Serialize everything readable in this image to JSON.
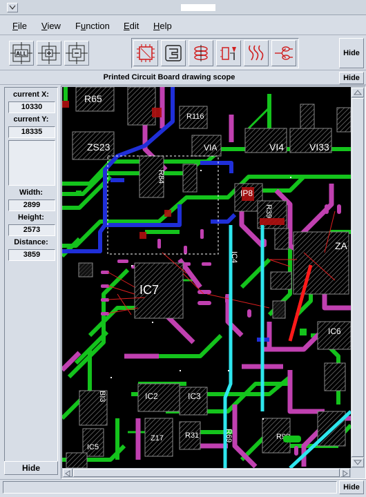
{
  "window": {
    "title_bar_label": "",
    "window_menu_icon": "window-menu-icon"
  },
  "menubar": {
    "items": [
      {
        "label": "File",
        "key": "F",
        "rest": "ile"
      },
      {
        "label": "View",
        "key": "V",
        "rest": "iew"
      },
      {
        "label": "Function",
        "key": "u",
        "pre": "F",
        "rest": "nction"
      },
      {
        "label": "Edit",
        "key": "E",
        "rest": "dit"
      },
      {
        "label": "Help",
        "key": "H",
        "rest": "elp"
      }
    ]
  },
  "toolbar": {
    "left_tools": [
      "zoom-all-icon",
      "zoom-in-icon",
      "zoom-out-icon"
    ],
    "zoom_all_label": "ALL",
    "right_tools": [
      "pcb-board-icon",
      "footprint-icon",
      "layers-icon",
      "component-probe-icon",
      "signal-traces-icon",
      "net-tree-icon"
    ],
    "hide_label": "Hide"
  },
  "scope_header": {
    "title": "Printed Circuit Board drawing scope",
    "hide_label": "Hide"
  },
  "info_panel": {
    "current_x_label": "current X:",
    "current_x": "10330",
    "current_y_label": "current Y:",
    "current_y": "18335",
    "width_label": "Width:",
    "width": "2899",
    "height_label": "Height:",
    "height": "2573",
    "distance_label": "Distance:",
    "distance": "3859",
    "hide_label": "Hide"
  },
  "canvas": {
    "component_labels": [
      "R65",
      "R116",
      "ZS23",
      "VIA",
      "VI4",
      "VI33",
      "R84",
      "IP8",
      "R39",
      "IC4",
      "IC7",
      "ZA",
      "IC6",
      "IC2",
      "IC3",
      "IC5",
      "R31",
      "R69",
      "R90",
      "Z17",
      "BI3"
    ],
    "colors": {
      "background": "#000000",
      "green": "#14c31c",
      "magenta": "#c040b0",
      "blue": "#1f2fd8",
      "cyan": "#2ee6ee",
      "red": "#ff1a1a"
    }
  },
  "statusbar": {
    "hide_label": "Hide"
  }
}
